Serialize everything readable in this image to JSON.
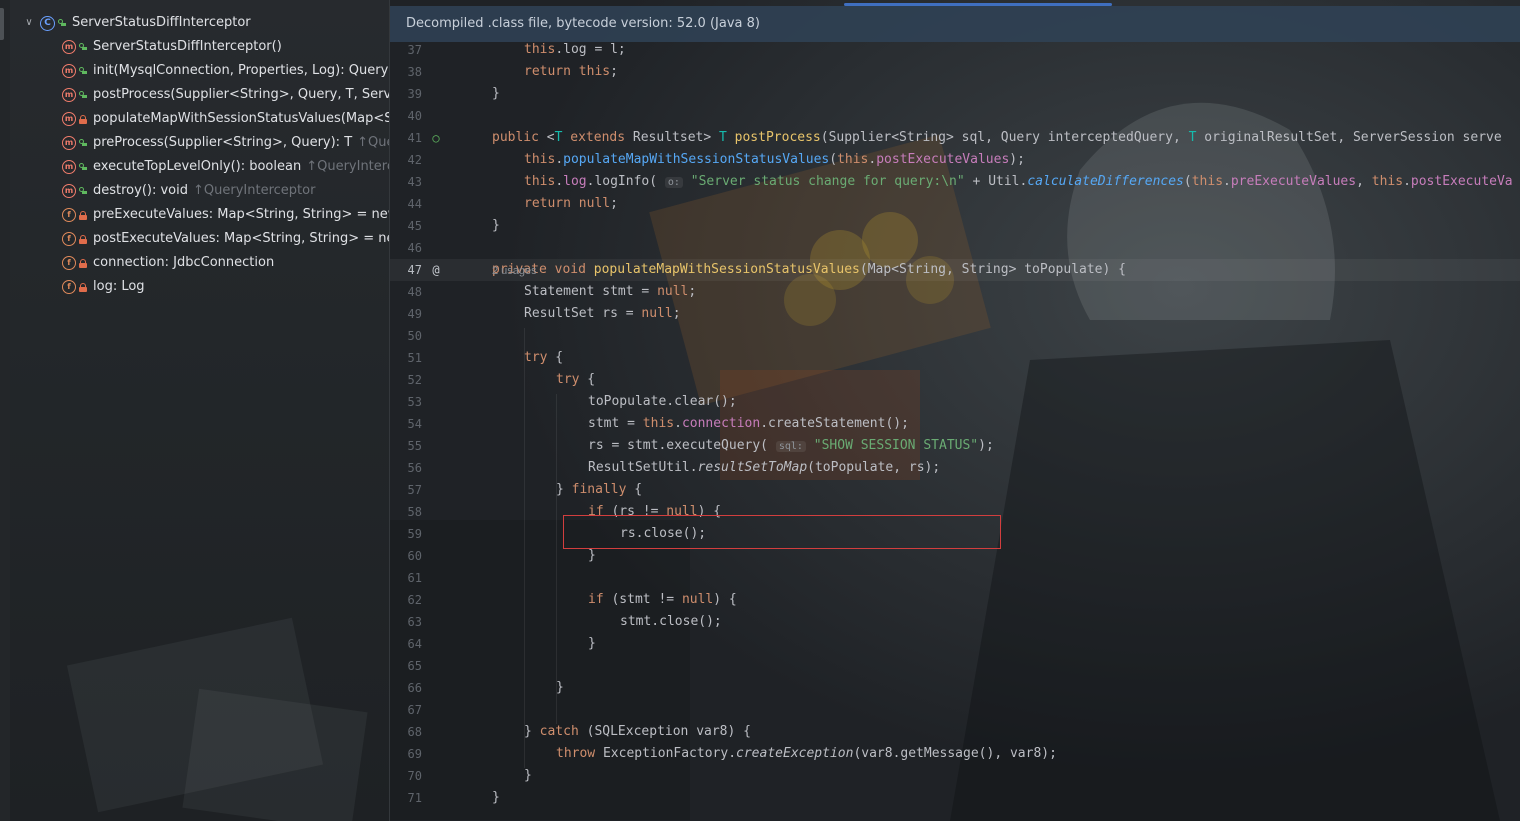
{
  "structure": {
    "class_node": {
      "label": "ServerStatusDiffInterceptor",
      "icon": "class-icon"
    },
    "members": [
      {
        "kind": "method",
        "visibility": "public",
        "label": "ServerStatusDiffInterceptor()",
        "hint": ""
      },
      {
        "kind": "method",
        "visibility": "public",
        "label": "init(MysqlConnection, Properties, Log): QueryI",
        "hint": ""
      },
      {
        "kind": "method",
        "visibility": "public",
        "label": "postProcess(Supplier<String>, Query, T, Serve",
        "hint": ""
      },
      {
        "kind": "method",
        "visibility": "private",
        "label": "populateMapWithSessionStatusValues(Map<St",
        "hint": ""
      },
      {
        "kind": "method",
        "visibility": "public",
        "label": "preProcess(Supplier<String>, Query): T",
        "hint": "↑Que"
      },
      {
        "kind": "method",
        "visibility": "public",
        "label": "executeTopLevelOnly(): boolean",
        "hint": "↑QueryInterc"
      },
      {
        "kind": "method",
        "visibility": "public",
        "label": "destroy(): void",
        "hint": "↑QueryInterceptor"
      },
      {
        "kind": "field",
        "visibility": "private",
        "label": "preExecuteValues: Map<String, String> = new",
        "hint": ""
      },
      {
        "kind": "field",
        "visibility": "private",
        "label": "postExecuteValues: Map<String, String> = nev",
        "hint": ""
      },
      {
        "kind": "field",
        "visibility": "private",
        "label": "connection: JdbcConnection",
        "hint": ""
      },
      {
        "kind": "field",
        "visibility": "private",
        "label": "log: Log",
        "hint": ""
      }
    ]
  },
  "editor": {
    "banner": "Decompiled .class file, bytecode version: 52.0 (Java 8)",
    "usages_hint": "2 usages",
    "current_line": 47,
    "highlighted_line": 56,
    "line_numbers": [
      "37",
      "38",
      "39",
      "40",
      "41",
      "42",
      "43",
      "44",
      "45",
      "46",
      "47",
      "48",
      "49",
      "50",
      "51",
      "52",
      "53",
      "54",
      "55",
      "56",
      "57",
      "58",
      "59",
      "60",
      "61",
      "62",
      "63",
      "64",
      "65",
      "66",
      "67",
      "68",
      "69",
      "70",
      "71"
    ],
    "code_text": {
      "l37": [
        "this",
        ".log = l;"
      ],
      "l38": [
        "return",
        " ",
        "this",
        ";"
      ],
      "l39": [
        "}"
      ],
      "l41": [
        "public",
        " <",
        "T",
        " ",
        "extends",
        " Resultset> ",
        "T",
        " ",
        "postProcess",
        "(Supplier<String> sql, Query interceptedQuery, ",
        "T",
        " originalResultSet, ServerSession serve"
      ],
      "l42": [
        "this",
        ".",
        "populateMapWithSessionStatusValues",
        "(",
        "this",
        ".",
        "postExecuteValues",
        ");"
      ],
      "l43": [
        "this",
        ".",
        "log",
        ".logInfo( ",
        "o:",
        " ",
        "\"Server status change for query:\\n\"",
        " + Util.",
        "calculateDifferences",
        "(",
        "this",
        ".",
        "preExecuteValues",
        ", ",
        "this",
        ".",
        "postExecuteVa"
      ],
      "l44": [
        "return",
        " ",
        "null",
        ";"
      ],
      "l45": [
        "}"
      ],
      "l47": [
        "private",
        " ",
        "void",
        " ",
        "populateMapWithSessionStatusValues",
        "(Map<String, String> toPopulate) {"
      ],
      "l48": [
        "Statement stmt = ",
        "null",
        ";"
      ],
      "l49": [
        "ResultSet rs = ",
        "null",
        ";"
      ],
      "l51": [
        "try",
        " {"
      ],
      "l52": [
        "try",
        " {"
      ],
      "l53": [
        "toPopulate.clear();"
      ],
      "l54": [
        "stmt = ",
        "this",
        ".",
        "connection",
        ".createStatement();"
      ],
      "l55": [
        "rs = stmt.executeQuery( ",
        "sql:",
        " ",
        "\"SHOW SESSION STATUS\"",
        ");"
      ],
      "l56": [
        "ResultSetUtil.",
        "resultSetToMap",
        "(toPopulate, rs);"
      ],
      "l57": [
        "} ",
        "finally",
        " {"
      ],
      "l58": [
        "if",
        " (rs != ",
        "null",
        ") {"
      ],
      "l59": [
        "rs.close();"
      ],
      "l60": [
        "}"
      ],
      "l62": [
        "if",
        " (stmt != ",
        "null",
        ") {"
      ],
      "l63": [
        "stmt.close();"
      ],
      "l64": [
        "}"
      ],
      "l66": [
        "}"
      ],
      "l68": [
        "} ",
        "catch",
        " (SQLException var8) {"
      ],
      "l69": [
        "throw",
        " ExceptionFactory.",
        "createException",
        "(var8.getMessage(), var8);"
      ],
      "l70": [
        "}"
      ],
      "l71": [
        "}"
      ]
    }
  },
  "colors": {
    "keyword": "#cf8e6d",
    "method_call": "#56a8f5",
    "method_decl": "#e8c46a",
    "field": "#c77dbb",
    "string": "#6aab73",
    "highlight_box": "#d23e3e",
    "accent": "#3f6fc0"
  },
  "icons": {
    "expand": "chevron-down-icon",
    "class": "class-icon",
    "method": "method-icon",
    "field": "field-icon",
    "public": "public-visibility-icon",
    "private": "private-lock-icon",
    "implements": "implements-gutter-icon",
    "annotation": "at-gutter-icon"
  }
}
